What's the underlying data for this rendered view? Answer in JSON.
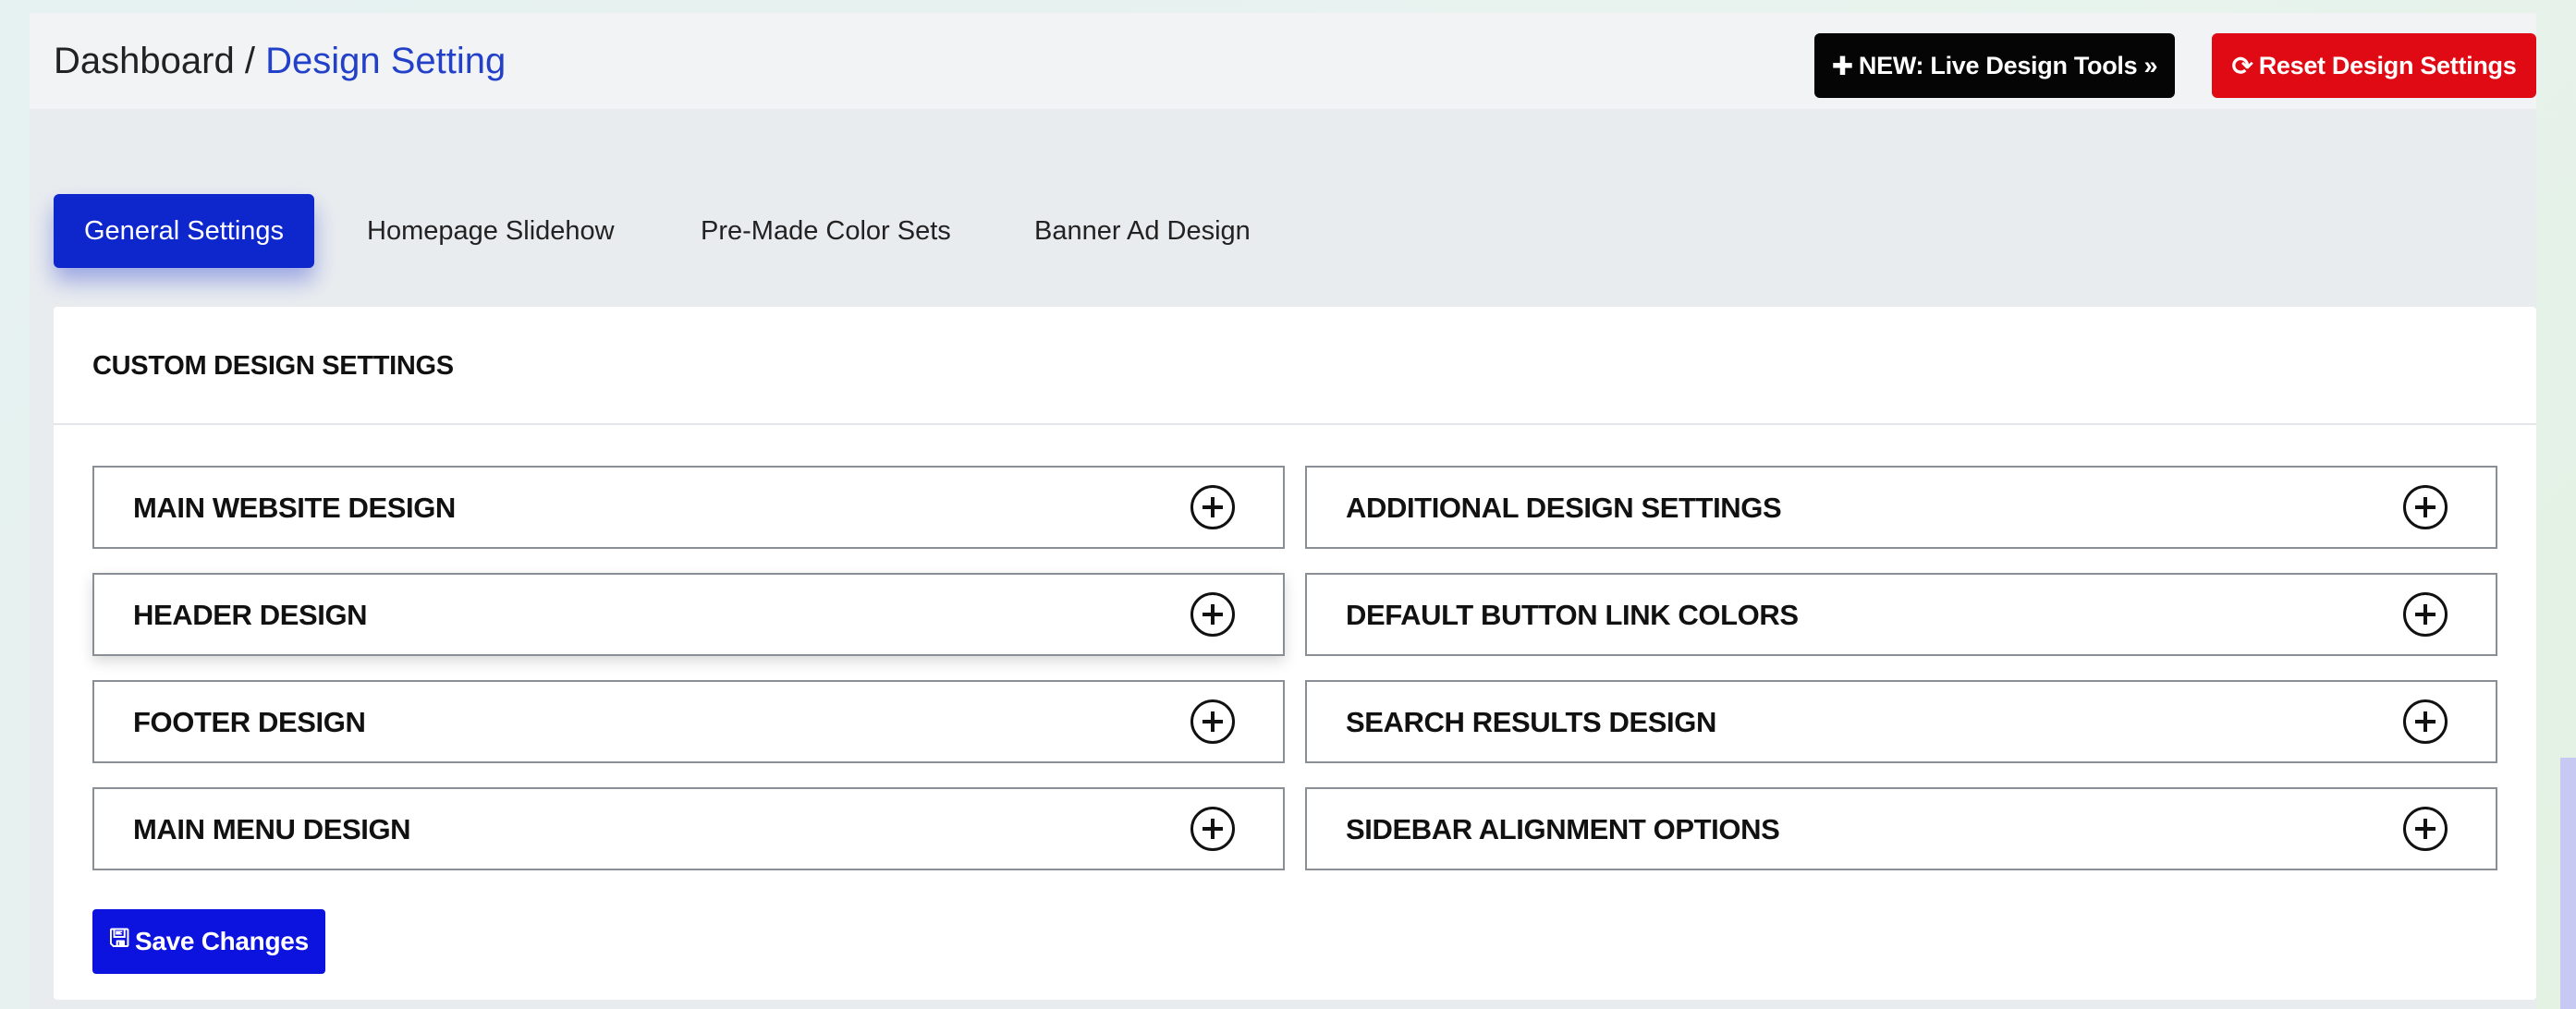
{
  "breadcrumb": {
    "root": "Dashboard",
    "separator": "/",
    "current": "Design Setting"
  },
  "header_buttons": {
    "live_tools": {
      "icon": "plus-icon",
      "label": "NEW: Live Design Tools »"
    },
    "reset": {
      "icon": "refresh-icon",
      "label": "Reset Design Settings"
    }
  },
  "tabs": [
    {
      "label": "General Settings",
      "active": true
    },
    {
      "label": "Homepage Slidehow",
      "active": false
    },
    {
      "label": "Pre-Made Color Sets",
      "active": false
    },
    {
      "label": "Banner Ad Design",
      "active": false
    }
  ],
  "card": {
    "title": "CUSTOM DESIGN SETTINGS",
    "panels": [
      {
        "label": "MAIN WEBSITE DESIGN"
      },
      {
        "label": "ADDITIONAL DESIGN SETTINGS"
      },
      {
        "label": "HEADER DESIGN"
      },
      {
        "label": "DEFAULT BUTTON LINK COLORS"
      },
      {
        "label": "FOOTER DESIGN"
      },
      {
        "label": "SEARCH RESULTS DESIGN"
      },
      {
        "label": "MAIN MENU DESIGN"
      },
      {
        "label": "SIDEBAR ALIGNMENT OPTIONS"
      }
    ],
    "save_button": {
      "icon": "floppy-disk-icon",
      "label": "Save Changes"
    }
  },
  "colors": {
    "breadcrumb_current": "#2340c9",
    "live_tools_bg": "#050505",
    "reset_bg": "#df0a13",
    "active_tab_bg": "#0d27cc",
    "save_bg": "#0d13df"
  }
}
